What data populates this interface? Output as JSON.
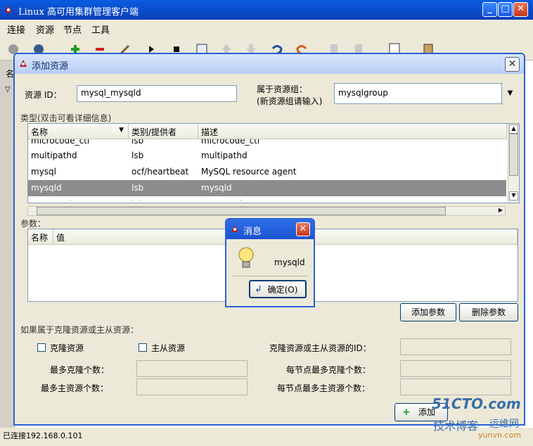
{
  "app": {
    "title": "Linux 高可用集群管理客户端",
    "window_controls": [
      "_",
      "□",
      "✕"
    ]
  },
  "menu": [
    "连接",
    "资源",
    "节点",
    "工具"
  ],
  "toolbar_icons": [
    "connect-icon",
    "disconnect-icon",
    "add-icon",
    "remove-icon",
    "cleanup-icon",
    "start-icon",
    "stop-icon",
    "config-icon",
    "up-icon",
    "down-icon",
    "undo-icon",
    "redo-icon",
    "move-icon",
    "move2-icon",
    "log-icon",
    "exit-icon"
  ],
  "status": {
    "text": "已连接192.168.0.101"
  },
  "main": {
    "col_prefix": "名"
  },
  "dialog": {
    "title": "添加资源",
    "resource_id_label": "资源 ID：",
    "resource_id_value": "mysql_mysqld",
    "group_label_1": "属于资源组：",
    "group_label_2": "(新资源组请输入)",
    "group_value": "mysqlgroup",
    "types_label": "类型(双击可看详细信息)",
    "types_headers": [
      "名称",
      "类别/提供者",
      "描述"
    ],
    "types_rows": [
      {
        "name": "microcode_ctl",
        "cls": "lsb",
        "desc": "microcode_ctl"
      },
      {
        "name": "multipathd",
        "cls": "lsb",
        "desc": "multipathd"
      },
      {
        "name": "mysql",
        "cls": "ocf/heartbeat",
        "desc": "MySQL resource agent"
      },
      {
        "name": "mysqld",
        "cls": "lsb",
        "desc": "mysqld"
      },
      {
        "name": "netconsole",
        "cls": "lsb",
        "desc": "netconsole"
      }
    ],
    "selected_row": 3,
    "params_label": "参数：",
    "params_headers": [
      "名称",
      "值"
    ],
    "add_param_button": "添加参数",
    "delete_param_button": "删除参数",
    "clone_label": "如果属于克隆资源或主从资源：",
    "clone_check": "克隆资源",
    "master_check": "主从资源",
    "clone_id_label": "克隆资源或主从资源的ID：",
    "max_clone_label": "最多克隆个数：",
    "max_master_label": "最多主资源个数：",
    "node_max_clone_label": "每节点最多克隆个数：",
    "node_max_master_label": "每节点最多主资源个数：",
    "add_button": "添加"
  },
  "message": {
    "title": "消息",
    "text": "mysqld",
    "ok_button": "确定(O)"
  },
  "watermark": {
    "line1": "51CTO.com",
    "line2": "技术博客",
    "line3": "运维网",
    "line4": "yunvn.com"
  }
}
